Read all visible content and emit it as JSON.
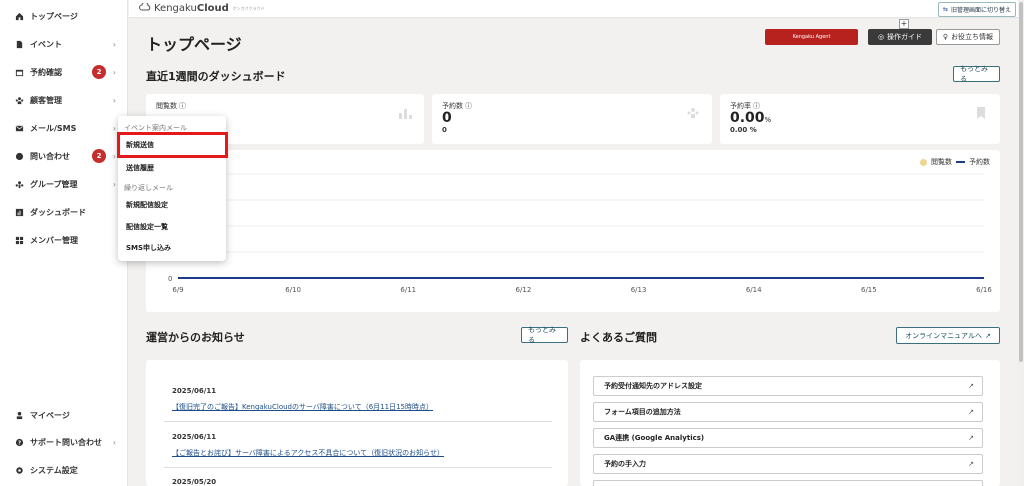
{
  "sidebar": {
    "items": [
      {
        "label": "トップページ",
        "icon": "home-icon",
        "chevron": false,
        "badge": ""
      },
      {
        "label": "イベント",
        "icon": "document-icon",
        "chevron": true,
        "badge": ""
      },
      {
        "label": "予約確認",
        "icon": "calendar-icon",
        "chevron": true,
        "badge": "2"
      },
      {
        "label": "顧客管理",
        "icon": "people-icon",
        "chevron": true,
        "badge": ""
      },
      {
        "label": "メール/SMS",
        "icon": "mail-icon",
        "chevron": true,
        "badge": ""
      },
      {
        "label": "問い合わせ",
        "icon": "chat-icon",
        "chevron": true,
        "badge": "2"
      },
      {
        "label": "グループ管理",
        "icon": "group-icon",
        "chevron": true,
        "badge": ""
      },
      {
        "label": "ダッシュボード",
        "icon": "chart-icon",
        "chevron": false,
        "badge": ""
      },
      {
        "label": "メンバー管理",
        "icon": "grid-icon",
        "chevron": false,
        "badge": ""
      }
    ],
    "bottom_items": [
      {
        "label": "マイページ",
        "icon": "user-icon",
        "chevron": false
      },
      {
        "label": "サポート問い合わせ",
        "icon": "help-icon",
        "chevron": true
      },
      {
        "label": "システム設定",
        "icon": "gear-icon",
        "chevron": false
      }
    ]
  },
  "header": {
    "logo_main": "Kengaku",
    "logo_bold": "Cloud",
    "logo_sub": "ケンガククラウド",
    "switch_label": "旧管理画面に切り替え",
    "page_title": "トップページ",
    "agent_label": "Kengaku Agent",
    "guide_label": "操作ガイド",
    "plus": "+",
    "tips_label": "お役立ち情報"
  },
  "dashboard": {
    "title": "直近1週間のダッシュボード",
    "more_label": "もっとみる",
    "stats": [
      {
        "label": "閲覧数",
        "value": "",
        "unit": "",
        "sub": ""
      },
      {
        "label": "予約数",
        "value": "0",
        "unit": "",
        "sub": "0"
      },
      {
        "label": "予約率",
        "value": "0.00",
        "unit": "%",
        "sub": "0.00 %"
      }
    ]
  },
  "chart_data": {
    "type": "line",
    "x": [
      "6/9",
      "6/10",
      "6/11",
      "6/12",
      "6/13",
      "6/14",
      "6/15",
      "6/16"
    ],
    "series": [
      {
        "name": "閲覧数",
        "values": [
          0,
          0,
          0,
          0,
          0,
          0,
          0,
          0
        ],
        "color": "#f0d592"
      },
      {
        "name": "予約数",
        "values": [
          0,
          0,
          0,
          0,
          0,
          0,
          0,
          0
        ],
        "color": "#1e3a8a"
      }
    ],
    "y_tick": "0",
    "grid": true,
    "legend_placement": "top-right"
  },
  "dropdown": {
    "group1": "イベント案内メール",
    "items1": [
      "新規送信",
      "送信履歴"
    ],
    "group2": "繰り返しメール",
    "items2": [
      "新規配信設定",
      "配信設定一覧",
      "SMS申し込み"
    ]
  },
  "news": {
    "title": "運営からのお知らせ",
    "more_label": "もっとみる",
    "items": [
      {
        "date": "2025/06/11",
        "title": "【復旧完了のご報告】KengakuCloudのサーバ障害について（6月11日15時時点）"
      },
      {
        "date": "2025/06/11",
        "title": "【ご報告とお詫び】サーバ障害によるアクセス不具合について（復旧状況のお知らせ）"
      },
      {
        "date": "2025/05/20",
        "title": ""
      }
    ]
  },
  "faq": {
    "title": "よくあるご質問",
    "manual_label": "オンラインマニュアルへ",
    "items": [
      "予約受付通知先のアドレス設定",
      "フォーム項目の追加方法",
      "GA連携 (Google Analytics)",
      "予約の手入力",
      ""
    ]
  }
}
